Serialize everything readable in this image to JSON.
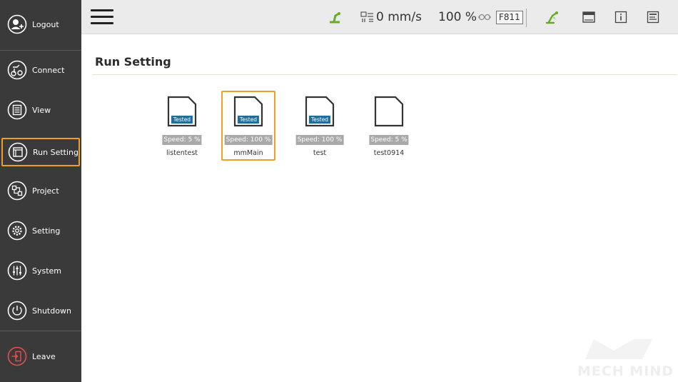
{
  "sidebar": {
    "items": [
      {
        "label": "Logout",
        "icon": "logout-icon"
      },
      {
        "label": "Connect",
        "icon": "connect-icon"
      },
      {
        "label": "View",
        "icon": "view-icon"
      },
      {
        "label": "Run Setting",
        "icon": "run-setting-icon",
        "active": true
      },
      {
        "label": "Project",
        "icon": "project-icon"
      },
      {
        "label": "Setting",
        "icon": "gear-icon"
      },
      {
        "label": "System",
        "icon": "sliders-icon"
      },
      {
        "label": "Shutdown",
        "icon": "power-icon"
      },
      {
        "label": "Leave",
        "icon": "exit-icon"
      }
    ]
  },
  "topbar": {
    "speed": "0 mm/s",
    "override": "100 %",
    "robot_id": "F811",
    "icons": [
      "robot-arm-icon",
      "speed-icon",
      "link-icon",
      "robot-tree-icon",
      "panel-icon",
      "info-icon",
      "log-icon"
    ]
  },
  "main": {
    "title": "Run Setting",
    "files": [
      {
        "name": "listentest",
        "speed": "Speed: 5 %",
        "tested": true,
        "tag": "Tested"
      },
      {
        "name": "mmMain",
        "speed": "Speed: 100 %",
        "tested": true,
        "tag": "Tested",
        "selected": true
      },
      {
        "name": "test",
        "speed": "Speed: 100 %",
        "tested": true,
        "tag": "Tested"
      },
      {
        "name": "test0914",
        "speed": "Speed: 5 %",
        "tested": false
      }
    ]
  },
  "watermark": {
    "text": "MECH MIND"
  },
  "colors": {
    "sidebar_bg": "#3a3a3a",
    "accent": "#f0a020",
    "tag_blue": "#1f6e9a",
    "robot_green": "#6aaa2a"
  }
}
